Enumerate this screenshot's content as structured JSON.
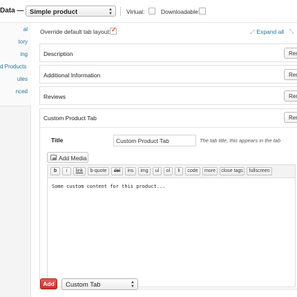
{
  "header": {
    "title": "Data —",
    "product_type": "Simple product",
    "virtual_label": "Virtual:",
    "virtual_checked": false,
    "downloadable_label": "Downloadable:",
    "downloadable_checked": false
  },
  "sidebar": {
    "items": [
      {
        "label": "al"
      },
      {
        "label": "tory"
      },
      {
        "label": "ing"
      },
      {
        "label": "d Products"
      },
      {
        "label": "utes"
      },
      {
        "label": "nced"
      }
    ]
  },
  "main": {
    "override_label": "Override default tab layout:",
    "override_checked": true,
    "expand_all": "Expand all",
    "remove_label": "Rem",
    "tabs": [
      {
        "name": "Description"
      },
      {
        "name": "Additional Information"
      },
      {
        "name": "Reviews"
      }
    ],
    "custom_tab": {
      "name": "Custom Product Tab",
      "title_label": "Title",
      "title_value": "Custom Product Tab",
      "title_hint": "The tab title, this appears in the tab",
      "add_media": "Add Media",
      "quicktags": [
        "b",
        "i",
        "link",
        "b-quote",
        "del",
        "ins",
        "img",
        "ul",
        "ol",
        "li",
        "code",
        "more",
        "close tags",
        "fullscreen"
      ],
      "content": "Some custom content for this product..."
    },
    "add_button": "Add",
    "add_select_value": "Custom Tab"
  }
}
